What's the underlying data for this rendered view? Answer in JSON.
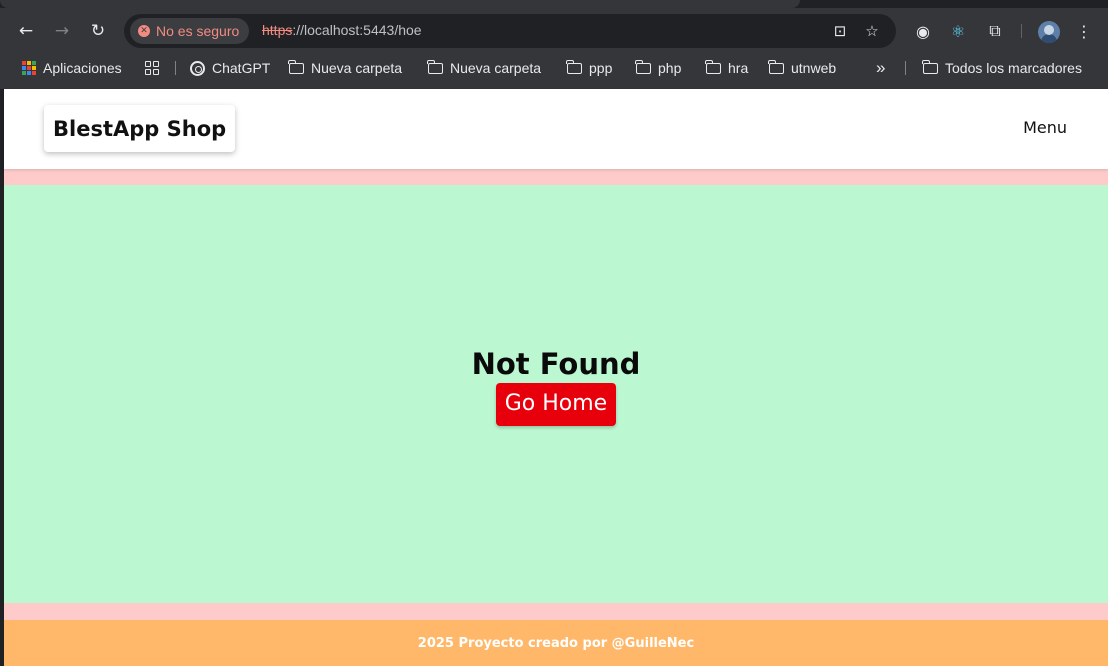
{
  "browser": {
    "security_label": "No es seguro",
    "url_scheme": "https",
    "url_rest": "://localhost:5443/hoe",
    "icons": {
      "back": "arrow-left-icon",
      "forward": "arrow-right-icon",
      "reload": "reload-icon",
      "translate": "translate-icon",
      "bookmark": "star-icon",
      "extensions": "puzzle-icon",
      "menu": "kebab-icon"
    },
    "bookmarks": [
      {
        "label": "Aplicaciones"
      },
      {
        "label": "ChatGPT"
      },
      {
        "label": "Nueva carpeta"
      },
      {
        "label": "Nueva carpeta"
      },
      {
        "label": "ppp"
      },
      {
        "label": "php"
      },
      {
        "label": "hra"
      },
      {
        "label": "utnweb"
      }
    ],
    "overflow_label": "»",
    "all_bookmarks_label": "Todos los marcadores"
  },
  "page": {
    "brand": "BlestApp Shop",
    "menu_label": "Menu",
    "not_found_title": "Not Found",
    "home_button_label": "Go Home",
    "footer_text": "2025 Proyecto creado por @GuilleNec"
  },
  "colors": {
    "page_accent_band": "#fecaca",
    "main_bg": "#bbf7d0",
    "button_bg": "#e7000b",
    "footer_bg": "#ffb86a"
  }
}
